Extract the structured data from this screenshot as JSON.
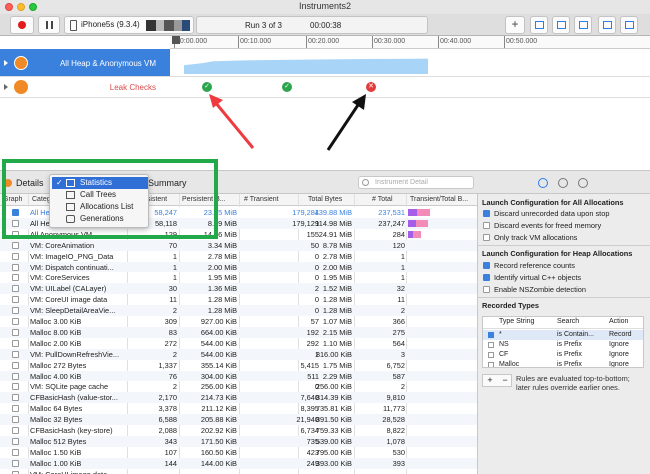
{
  "window": {
    "title": "Instruments2"
  },
  "toolbar": {
    "device": "iPhone5s (9.3.4)",
    "run": "Run 3 of 3",
    "time": "00:00:38",
    "add_label": "+"
  },
  "timeline": {
    "ticks": [
      "00:00.000",
      "00:10.000",
      "00:20.000",
      "00:30.000",
      "00:40.000",
      "00:50.000"
    ],
    "tracks": [
      {
        "name": "All Heap & Anonymous VM"
      },
      {
        "name": "Leak Checks"
      }
    ]
  },
  "detail": {
    "label": "Details",
    "summary_label": "Summary",
    "search_placeholder": "Instrument Detail",
    "menu": [
      {
        "label": "Statistics",
        "checked": true,
        "icon": "table-icon"
      },
      {
        "label": "Call Trees",
        "checked": false,
        "icon": "list-icon"
      },
      {
        "label": "Allocations List",
        "checked": false,
        "icon": "grid-icon"
      },
      {
        "label": "Generations",
        "checked": false,
        "icon": "camera-icon"
      }
    ]
  },
  "table": {
    "columns": [
      "Graph",
      "Category",
      "Persistent",
      "Persistent B...",
      "# Transient",
      "Total Bytes",
      "# Total",
      "Transient/Total B..."
    ],
    "rows": [
      {
        "checked": true,
        "name": "All Heap & Anonymous VM",
        "persistent": "58,247",
        "pbytes": "23.35 MiB",
        "transient": "179,284",
        "tbytes": "139.88 MiB",
        "total": "237,531",
        "bar": 0.34,
        "selected": true
      },
      {
        "checked": false,
        "name": "All Heap Allocations",
        "persistent": "58,118",
        "pbytes": "8.49 MiB",
        "transient": "179,129",
        "tbytes": "114.98 MiB",
        "total": "237,247",
        "bar": 0.3
      },
      {
        "checked": false,
        "name": "All Anonymous VM",
        "persistent": "129",
        "pbytes": "14.86 MiB",
        "transient": "155",
        "tbytes": "24.91 MiB",
        "total": "284",
        "bar": 0.2
      },
      {
        "checked": false,
        "name": "VM: CoreAnimation",
        "persistent": "70",
        "pbytes": "3.34 MiB",
        "transient": "50",
        "tbytes": "8.78 MiB",
        "total": "120"
      },
      {
        "checked": false,
        "name": "VM: ImageIO_PNG_Data",
        "persistent": "1",
        "pbytes": "2.78 MiB",
        "transient": "0",
        "tbytes": "2.78 MiB",
        "total": "1"
      },
      {
        "checked": false,
        "name": "VM: Dispatch continuati...",
        "persistent": "1",
        "pbytes": "2.00 MiB",
        "transient": "0",
        "tbytes": "2.00 MiB",
        "total": "1"
      },
      {
        "checked": false,
        "name": "VM: CoreServices",
        "persistent": "1",
        "pbytes": "1.95 MiB",
        "transient": "0",
        "tbytes": "1.95 MiB",
        "total": "1"
      },
      {
        "checked": false,
        "name": "VM: UILabel (CALayer)",
        "persistent": "30",
        "pbytes": "1.36 MiB",
        "transient": "2",
        "tbytes": "1.52 MiB",
        "total": "32"
      },
      {
        "checked": false,
        "name": "VM: CoreUI image data",
        "persistent": "11",
        "pbytes": "1.28 MiB",
        "transient": "0",
        "tbytes": "1.28 MiB",
        "total": "11"
      },
      {
        "checked": false,
        "name": "VM: SleepDetailAreaVie...",
        "persistent": "2",
        "pbytes": "1.28 MiB",
        "transient": "0",
        "tbytes": "1.28 MiB",
        "total": "2"
      },
      {
        "checked": false,
        "name": "Malloc 3.00 KiB",
        "persistent": "309",
        "pbytes": "927.00 KiB",
        "transient": "57",
        "tbytes": "1.07 MiB",
        "total": "366"
      },
      {
        "checked": false,
        "name": "Malloc 8.00 KiB",
        "persistent": "83",
        "pbytes": "664.00 KiB",
        "transient": "192",
        "tbytes": "2.15 MiB",
        "total": "275"
      },
      {
        "checked": false,
        "name": "Malloc 2.00 KiB",
        "persistent": "272",
        "pbytes": "544.00 KiB",
        "transient": "292",
        "tbytes": "1.10 MiB",
        "total": "564"
      },
      {
        "checked": false,
        "name": "VM: PullDownRefreshVie...",
        "persistent": "2",
        "pbytes": "544.00 KiB",
        "transient": "1",
        "tbytes": "816.00 KiB",
        "total": "3"
      },
      {
        "checked": false,
        "name": "Malloc 272 Bytes",
        "persistent": "1,337",
        "pbytes": "355.14 KiB",
        "transient": "5,415",
        "tbytes": "1.75 MiB",
        "total": "6,752"
      },
      {
        "checked": false,
        "name": "Malloc 4.00 KiB",
        "persistent": "76",
        "pbytes": "304.00 KiB",
        "transient": "511",
        "tbytes": "2.29 MiB",
        "total": "587"
      },
      {
        "checked": false,
        "name": "VM: SQLite page cache",
        "persistent": "2",
        "pbytes": "256.00 KiB",
        "transient": "0",
        "tbytes": "256.00 KiB",
        "total": "2"
      },
      {
        "checked": false,
        "name": "CFBasicHash (value-stor...",
        "persistent": "2,170",
        "pbytes": "214.73 KiB",
        "transient": "7,640",
        "tbytes": "814.39 KiB",
        "total": "9,810"
      },
      {
        "checked": false,
        "name": "Malloc 64 Bytes",
        "persistent": "3,378",
        "pbytes": "211.12 KiB",
        "transient": "8,395",
        "tbytes": "735.81 KiB",
        "total": "11,773"
      },
      {
        "checked": false,
        "name": "Malloc 32 Bytes",
        "persistent": "6,588",
        "pbytes": "205.88 KiB",
        "transient": "21,940",
        "tbytes": "891.50 KiB",
        "total": "28,528"
      },
      {
        "checked": false,
        "name": "CFBasicHash (key-store)",
        "persistent": "2,088",
        "pbytes": "202.92 KiB",
        "transient": "6,734",
        "tbytes": "759.33 KiB",
        "total": "8,822"
      },
      {
        "checked": false,
        "name": "Malloc 512 Bytes",
        "persistent": "343",
        "pbytes": "171.50 KiB",
        "transient": "735",
        "tbytes": "539.00 KiB",
        "total": "1,078"
      },
      {
        "checked": false,
        "name": "Malloc 1.50 KiB",
        "persistent": "107",
        "pbytes": "160.50 KiB",
        "transient": "423",
        "tbytes": "795.00 KiB",
        "total": "530"
      },
      {
        "checked": false,
        "name": "Malloc 1.00 KiB",
        "persistent": "144",
        "pbytes": "144.00 KiB",
        "transient": "249",
        "tbytes": "393.00 KiB",
        "total": "393"
      },
      {
        "checked": false,
        "name": "VM: CoreUI image data",
        "persistent": "",
        "pbytes": "",
        "transient": "",
        "tbytes": "",
        "total": ""
      }
    ]
  },
  "inspector": {
    "all_alloc_title": "Launch Configuration for All Allocations",
    "opt_discard_unrecorded": "Discard unrecorded data upon stop",
    "opt_discard_events": "Discard events for freed memory",
    "opt_only_vm": "Only track VM allocations",
    "heap_title": "Launch Configuration for Heap Allocations",
    "opt_record_refcounts": "Record reference counts",
    "opt_identify_cpp": "Identify virtual C++ objects",
    "opt_nszombie": "Enable NSZombie detection",
    "recorded_title": "Recorded Types",
    "rt_columns": [
      "Type String",
      "Search",
      "Action"
    ],
    "rt_rows": [
      {
        "checked": true,
        "type": "*",
        "search": "is Contain...",
        "action": "Record"
      },
      {
        "checked": false,
        "type": "NS",
        "search": "is Prefix",
        "action": "Ignore"
      },
      {
        "checked": false,
        "type": "CF",
        "search": "is Prefix",
        "action": "Ignore"
      },
      {
        "checked": false,
        "type": "Malloc",
        "search": "is Prefix",
        "action": "Ignore"
      }
    ],
    "rule_note": "Rules are evaluated top-to-bottom; later rules override earlier ones.",
    "add_rule": "+",
    "remove_rule": "−"
  },
  "colors": {
    "accent": "#3a81de",
    "record": "#e21b1b",
    "highlight": "#22a94a",
    "bar_transient": "#a45ee8",
    "bar_persistent": "#f28bb8"
  }
}
